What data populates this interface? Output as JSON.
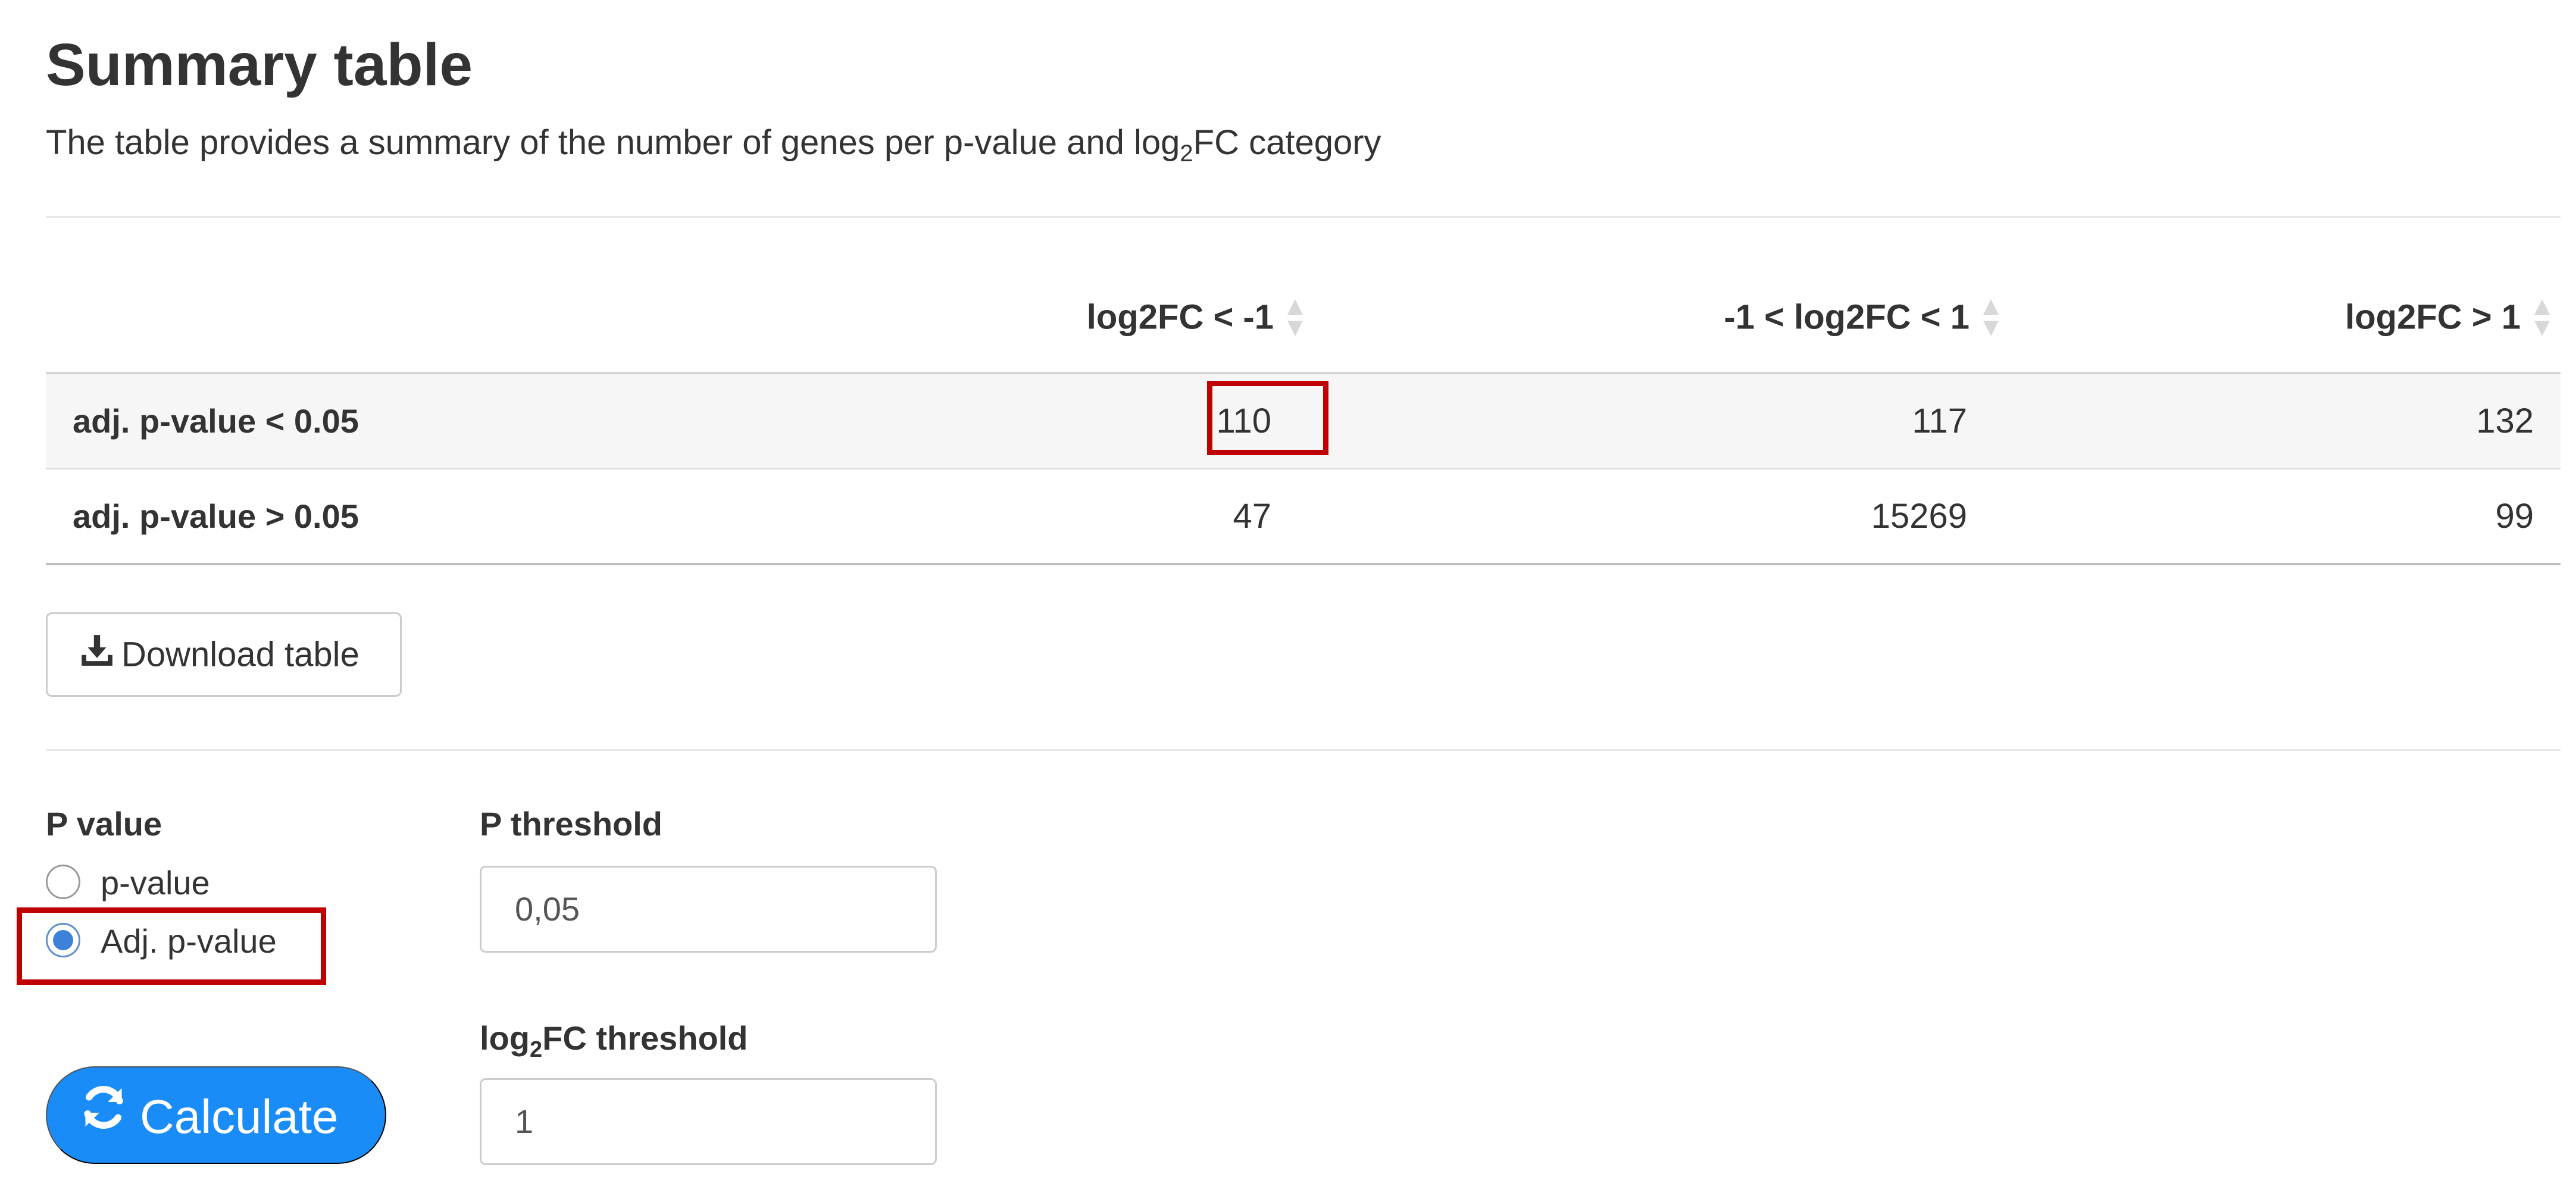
{
  "header": {
    "title": "Summary table",
    "subtitle_prefix": "The table provides a summary of the number of genes per p-value and log",
    "subtitle_sub": "2",
    "subtitle_suffix": "FC category"
  },
  "table": {
    "columns": [
      "",
      "log2FC < -1",
      "-1 < log2FC < 1",
      "log2FC > 1"
    ],
    "rows": [
      {
        "label": "adj. p-value < 0.05",
        "values": [
          "110",
          "117",
          "132"
        ]
      },
      {
        "label": "adj. p-value > 0.05",
        "values": [
          "47",
          "15269",
          "99"
        ]
      }
    ]
  },
  "download": {
    "label": "Download table",
    "icon": "download-icon"
  },
  "form": {
    "p_value_label": "P value",
    "p_options": [
      {
        "label": "p-value",
        "checked": false
      },
      {
        "label": "Adj. p-value",
        "checked": true
      }
    ],
    "p_threshold_label": "P threshold",
    "p_threshold_value": "0,05",
    "log2fc_label_prefix": "log",
    "log2fc_label_sub": "2",
    "log2fc_label_suffix": "FC threshold",
    "log2fc_threshold_value": "1"
  },
  "calculate": {
    "label": "Calculate",
    "icon": "refresh-icon"
  },
  "colors": {
    "highlight": "#c00000",
    "primary_button": "#1a8cf8",
    "radio_checked": "#3d82d8"
  }
}
